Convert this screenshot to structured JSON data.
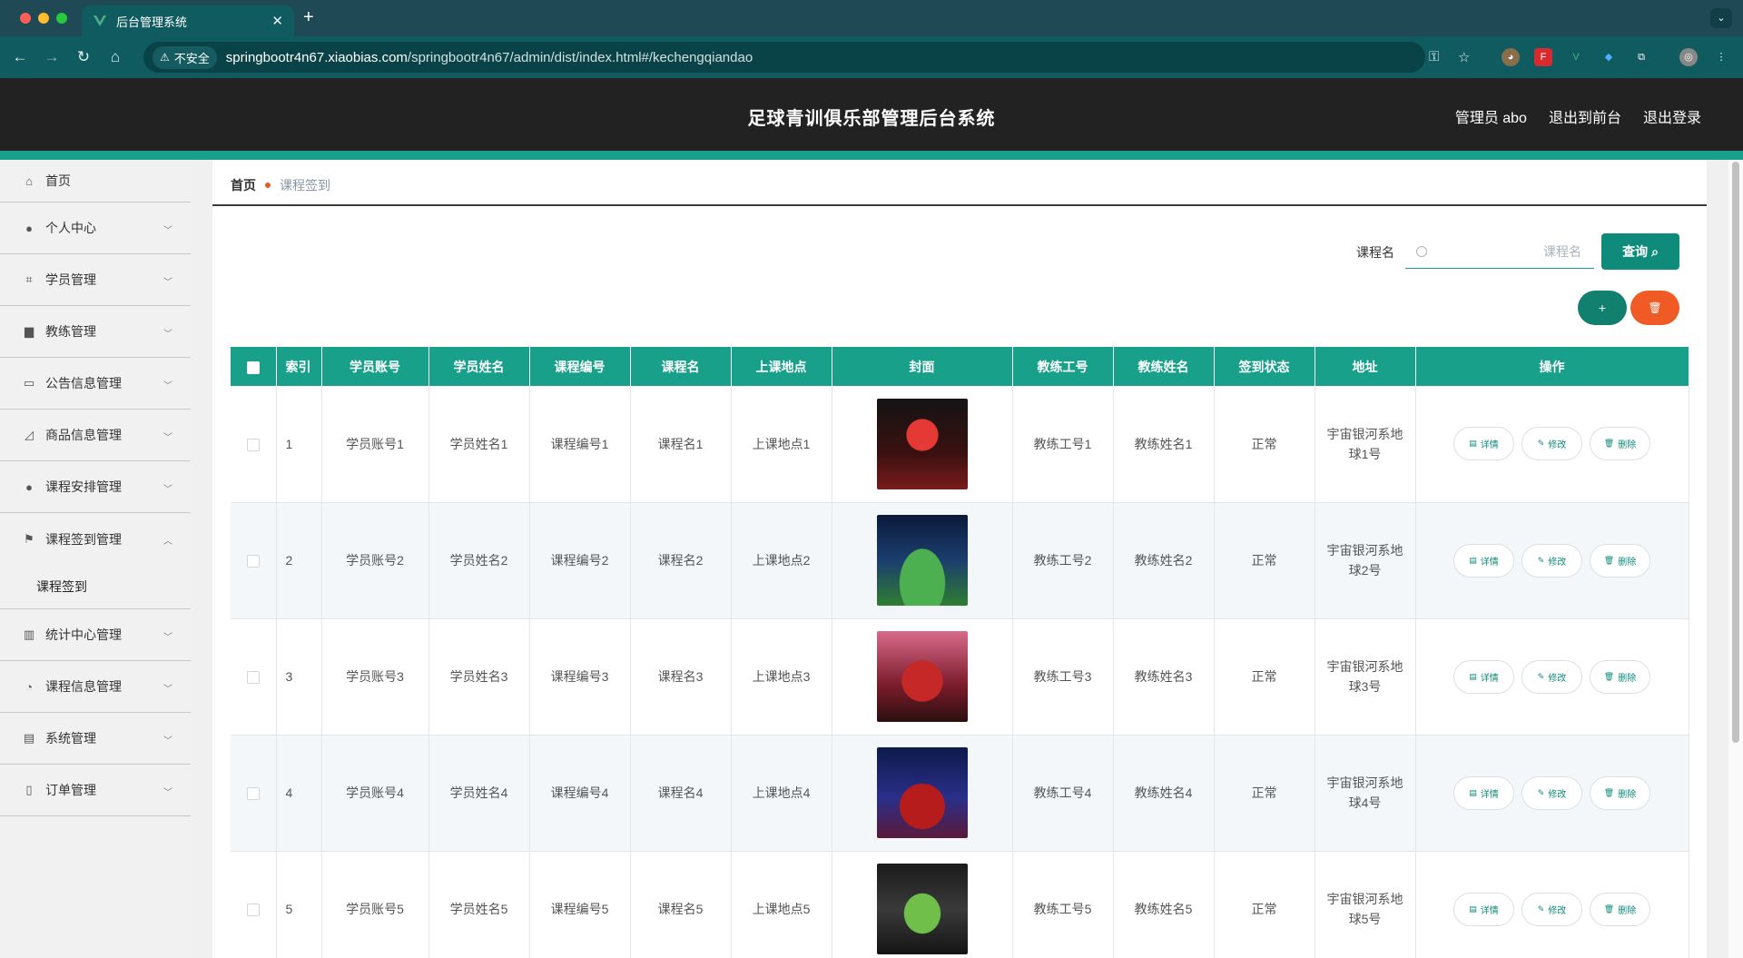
{
  "browser": {
    "tab_title": "后台管理系统",
    "tab_close": "✕",
    "new_tab": "+",
    "tab_menu": "⌄",
    "security_label": "不安全",
    "url_host": "springbootr4n67.xiaobias.com",
    "url_path": "/springbootr4n67/admin/dist/index.html#/kechengqiandao",
    "colors": {
      "tabbar": "#1f4a55",
      "toolbar": "#0f5b5f"
    }
  },
  "header": {
    "title": "足球青训俱乐部管理后台系统",
    "admin_label": "管理员 abo",
    "back_to_front": "退出到前台",
    "logout": "退出登录"
  },
  "sidebar": {
    "items": [
      {
        "label": "首页",
        "icon": "home-icon"
      },
      {
        "label": "个人中心",
        "icon": "user-icon"
      },
      {
        "label": "学员管理",
        "icon": "crop-icon"
      },
      {
        "label": "教练管理",
        "icon": "briefcase-icon"
      },
      {
        "label": "公告信息管理",
        "icon": "id-card-icon"
      },
      {
        "label": "商品信息管理",
        "icon": "chart-icon"
      },
      {
        "label": "课程安排管理",
        "icon": "user-icon"
      },
      {
        "label": "课程签到管理",
        "icon": "flag-icon"
      },
      {
        "label": "统计中心管理",
        "icon": "bar-chart-icon"
      },
      {
        "label": "课程信息管理",
        "icon": "gauge-icon"
      },
      {
        "label": "系统管理",
        "icon": "clipboard-icon"
      },
      {
        "label": "订单管理",
        "icon": "mic-icon"
      }
    ],
    "active_sub": "课程签到"
  },
  "breadcrumb": {
    "home": "首页",
    "current": "课程签到"
  },
  "search": {
    "label": "课程名",
    "placeholder": "课程名",
    "button": "查询"
  },
  "actions": {
    "add": "+",
    "delete": "🗑"
  },
  "table": {
    "headers": [
      "索引",
      "学员账号",
      "学员姓名",
      "课程编号",
      "课程名",
      "上课地点",
      "封面",
      "教练工号",
      "教练姓名",
      "签到状态",
      "地址",
      "操作"
    ],
    "row_buttons": {
      "detail": "详情",
      "edit": "修改",
      "delete": "删除"
    },
    "rows": [
      {
        "index": "1",
        "account": "学员账号1",
        "name": "学员姓名1",
        "course_no": "课程编号1",
        "course": "课程名1",
        "place": "上课地点1",
        "coach_no": "教练工号1",
        "coach": "教练姓名1",
        "status": "正常",
        "address": "宇宙银河系地球1号"
      },
      {
        "index": "2",
        "account": "学员账号2",
        "name": "学员姓名2",
        "course_no": "课程编号2",
        "course": "课程名2",
        "place": "上课地点2",
        "coach_no": "教练工号2",
        "coach": "教练姓名2",
        "status": "正常",
        "address": "宇宙银河系地球2号"
      },
      {
        "index": "3",
        "account": "学员账号3",
        "name": "学员姓名3",
        "course_no": "课程编号3",
        "course": "课程名3",
        "place": "上课地点3",
        "coach_no": "教练工号3",
        "coach": "教练姓名3",
        "status": "正常",
        "address": "宇宙银河系地球3号"
      },
      {
        "index": "4",
        "account": "学员账号4",
        "name": "学员姓名4",
        "course_no": "课程编号4",
        "course": "课程名4",
        "place": "上课地点4",
        "coach_no": "教练工号4",
        "coach": "教练姓名4",
        "status": "正常",
        "address": "宇宙银河系地球4号"
      },
      {
        "index": "5",
        "account": "学员账号5",
        "name": "学员姓名5",
        "course_no": "课程编号5",
        "course": "课程名5",
        "place": "上课地点5",
        "coach_no": "教练工号5",
        "coach": "教练姓名5",
        "status": "正常",
        "address": "宇宙银河系地球5号"
      }
    ]
  },
  "colors": {
    "accent": "#19a08a",
    "danger": "#f05a24",
    "header_bg": "#222222"
  }
}
